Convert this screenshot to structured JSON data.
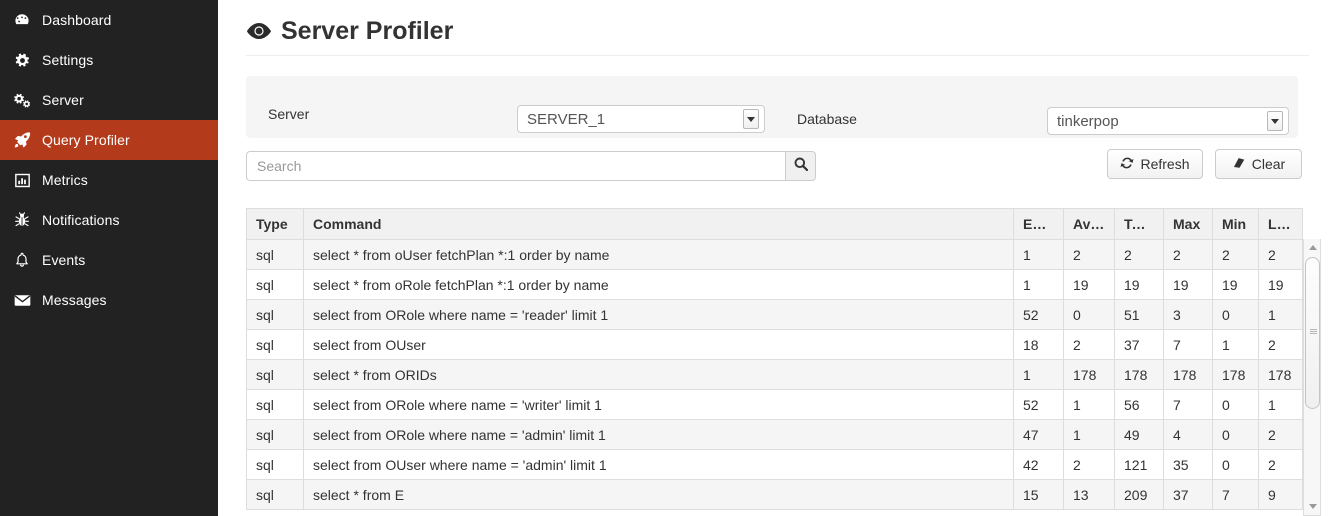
{
  "sidebar": {
    "items": [
      {
        "label": "Dashboard",
        "icon": "dashboard-icon",
        "active": false
      },
      {
        "label": "Settings",
        "icon": "gear-icon",
        "active": false
      },
      {
        "label": "Server",
        "icon": "cogs-icon",
        "active": false
      },
      {
        "label": "Query Profiler",
        "icon": "rocket-icon",
        "active": true
      },
      {
        "label": "Metrics",
        "icon": "bar-chart-icon",
        "active": false
      },
      {
        "label": "Notifications",
        "icon": "bug-icon",
        "active": false
      },
      {
        "label": "Events",
        "icon": "bell-icon",
        "active": false
      },
      {
        "label": "Messages",
        "icon": "envelope-icon",
        "active": false
      }
    ],
    "active_color": "#b33a1a",
    "background_color": "#222222"
  },
  "header": {
    "title": "Server Profiler",
    "icon": "eye-icon"
  },
  "filters": {
    "server_label": "Server",
    "server_value": "SERVER_1",
    "server_options": [
      "SERVER_1"
    ],
    "database_label": "Database",
    "database_value": "tinkerpop",
    "database_options": [
      "tinkerpop"
    ]
  },
  "toolbar": {
    "search_placeholder": "Search",
    "search_value": "",
    "search_icon": "search-icon",
    "refresh_label": "Refresh",
    "refresh_icon": "refresh-icon",
    "clear_label": "Clear",
    "clear_icon": "eraser-icon"
  },
  "table": {
    "columns": [
      "Type",
      "Command",
      "Exe...",
      "Ave...",
      "Total",
      "Max",
      "Min",
      "Last"
    ],
    "rows": [
      {
        "type": "sql",
        "command": "select * from oUser fetchPlan *:1 order by name",
        "exe": "1",
        "ave": "2",
        "total": "2",
        "max": "2",
        "min": "2",
        "last": "2"
      },
      {
        "type": "sql",
        "command": "select * from oRole fetchPlan *:1 order by name",
        "exe": "1",
        "ave": "19",
        "total": "19",
        "max": "19",
        "min": "19",
        "last": "19"
      },
      {
        "type": "sql",
        "command": "select from ORole where name = 'reader' limit 1",
        "exe": "52",
        "ave": "0",
        "total": "51",
        "max": "3",
        "min": "0",
        "last": "1"
      },
      {
        "type": "sql",
        "command": "select from OUser",
        "exe": "18",
        "ave": "2",
        "total": "37",
        "max": "7",
        "min": "1",
        "last": "2"
      },
      {
        "type": "sql",
        "command": "select * from ORIDs",
        "exe": "1",
        "ave": "178",
        "total": "178",
        "max": "178",
        "min": "178",
        "last": "178"
      },
      {
        "type": "sql",
        "command": "select from ORole where name = 'writer' limit 1",
        "exe": "52",
        "ave": "1",
        "total": "56",
        "max": "7",
        "min": "0",
        "last": "1"
      },
      {
        "type": "sql",
        "command": "select from ORole where name = 'admin' limit 1",
        "exe": "47",
        "ave": "1",
        "total": "49",
        "max": "4",
        "min": "0",
        "last": "2"
      },
      {
        "type": "sql",
        "command": "select from OUser where name = 'admin' limit 1",
        "exe": "42",
        "ave": "2",
        "total": "121",
        "max": "35",
        "min": "0",
        "last": "2"
      },
      {
        "type": "sql",
        "command": "select * from E",
        "exe": "15",
        "ave": "13",
        "total": "209",
        "max": "37",
        "min": "7",
        "last": "9"
      }
    ]
  }
}
